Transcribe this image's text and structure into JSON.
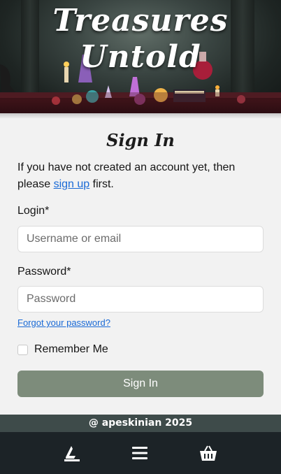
{
  "brand": {
    "title_line1": "Treasures",
    "title_line2": "Untold"
  },
  "signin": {
    "title": "Sign In",
    "intro_before": "If you have not created an account yet, then please ",
    "signup_link": "sign up",
    "intro_after": " first.",
    "login_label": "Login*",
    "login_placeholder": "Username or email",
    "password_label": "Password*",
    "password_placeholder": "Password",
    "forgot_link": "Forgot your password?",
    "remember_label": "Remember Me",
    "submit_label": "Sign In"
  },
  "footer": {
    "copyright": "@ apeskinian 2025"
  },
  "bottom_nav": {
    "items": [
      "home-icon",
      "menu-icon",
      "basket-icon"
    ]
  },
  "colors": {
    "button": "#7d8c7b",
    "link": "#1a6ad6",
    "footer_strip": "#3e4b4a",
    "bottom_nav": "#1c2327"
  }
}
